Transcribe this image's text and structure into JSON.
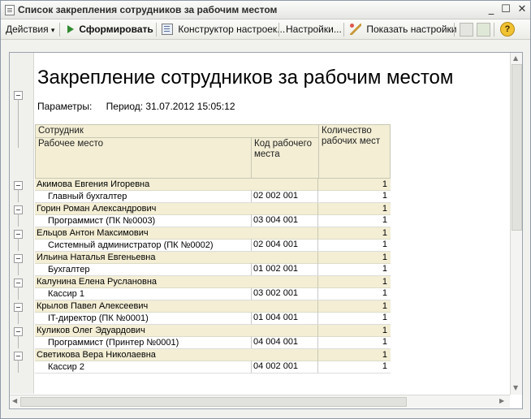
{
  "window": {
    "title": "Список закрепления сотрудников за рабочим местом",
    "min_glyph": "_",
    "max_glyph": "☐",
    "close_glyph": "✕"
  },
  "toolbar": {
    "actions_label": "Действия",
    "actions_arrow": "▾",
    "generate_label": "Сформировать",
    "constructor_label": "Конструктор настроек...",
    "settings_label": "Настройки...",
    "show_settings_label": "Показать настройки",
    "help_glyph": "?"
  },
  "report": {
    "title": "Закрепление сотрудников за рабочим местом",
    "params_label": "Параметры:",
    "params_value": "Период: 31.07.2012 15:05:12"
  },
  "table": {
    "headers": {
      "employee": "Сотрудник",
      "workplace": "Рабочее место",
      "code": "Код рабочего места",
      "count": "Количество рабочих мест"
    },
    "groups": [
      {
        "employee": "Акимова Евгения Игоревна",
        "count": "1",
        "workplace": "Главный бухгалтер",
        "code": "02 002 001",
        "wp_count": "1"
      },
      {
        "employee": "Горин Роман Александрович",
        "count": "1",
        "workplace": "Программист (ПК №0003)",
        "code": "03 004 001",
        "wp_count": "1"
      },
      {
        "employee": "Ельцов Антон Максимович",
        "count": "1",
        "workplace": "Системный администратор (ПК №0002)",
        "code": "02 004 001",
        "wp_count": "1"
      },
      {
        "employee": "Ильина Наталья Евгеньевна",
        "count": "1",
        "workplace": "Бухгалтер",
        "code": "01 002 001",
        "wp_count": "1"
      },
      {
        "employee": "Калунина Елена Руслановна",
        "count": "1",
        "workplace": "Кассир 1",
        "code": "03 002 001",
        "wp_count": "1"
      },
      {
        "employee": "Крылов Павел Алексеевич",
        "count": "1",
        "workplace": "IT-директор (ПК №0001)",
        "code": "01 004 001",
        "wp_count": "1"
      },
      {
        "employee": "Куликов Олег Эдуардович",
        "count": "1",
        "workplace": "Программист (Принтер №0001)",
        "code": "04 004 001",
        "wp_count": "1"
      },
      {
        "employee": "Светикова Вера Николаевна",
        "count": "1",
        "workplace": "Кассир 2",
        "code": "04 002 001",
        "wp_count": "1"
      }
    ]
  }
}
